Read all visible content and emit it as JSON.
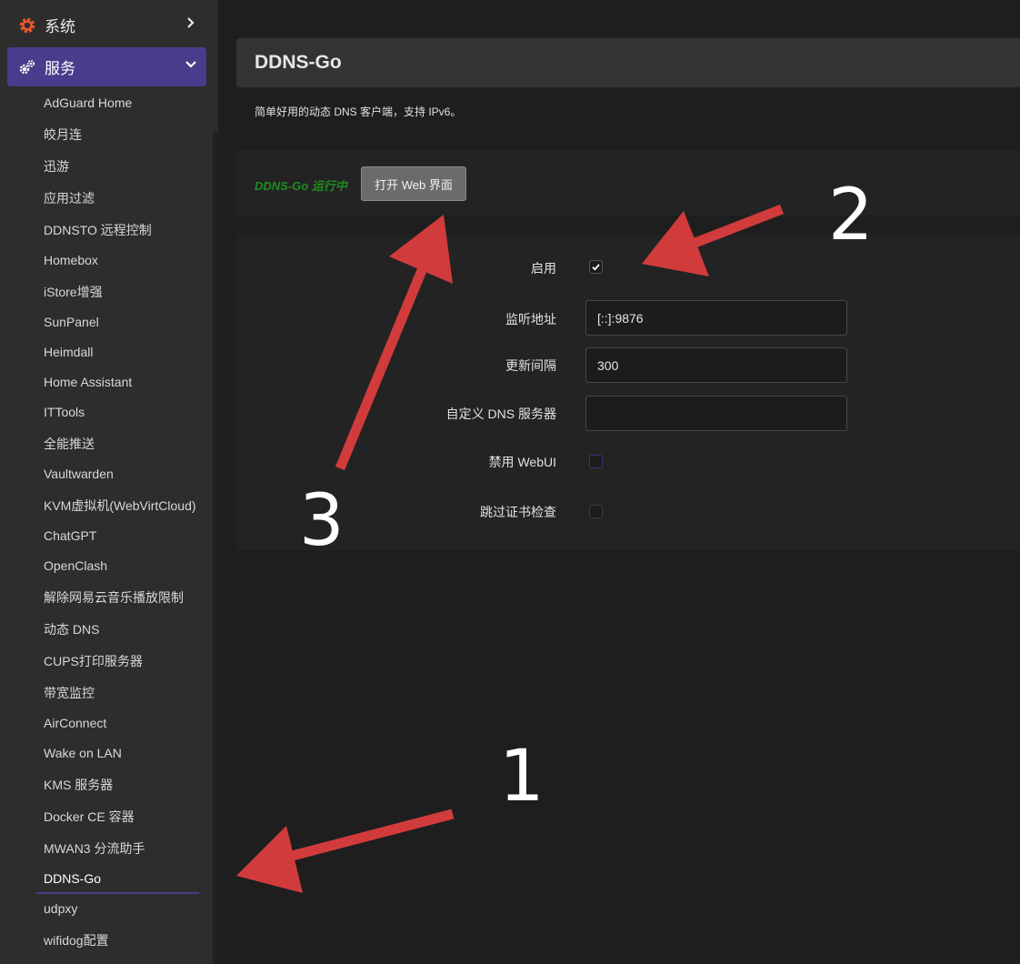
{
  "sidebar": {
    "system_label": "系统",
    "services_label": "服务",
    "items": [
      {
        "label": "AdGuard Home"
      },
      {
        "label": "皎月连"
      },
      {
        "label": "迅游"
      },
      {
        "label": "应用过滤"
      },
      {
        "label": "DDNSTO 远程控制"
      },
      {
        "label": "Homebox"
      },
      {
        "label": "iStore增强"
      },
      {
        "label": "SunPanel"
      },
      {
        "label": "Heimdall"
      },
      {
        "label": "Home Assistant"
      },
      {
        "label": "ITTools"
      },
      {
        "label": "全能推送"
      },
      {
        "label": "Vaultwarden"
      },
      {
        "label": "KVM虚拟机(WebVirtCloud)"
      },
      {
        "label": "ChatGPT"
      },
      {
        "label": "OpenClash"
      },
      {
        "label": "解除网易云音乐播放限制"
      },
      {
        "label": "动态 DNS"
      },
      {
        "label": "CUPS打印服务器"
      },
      {
        "label": "带宽监控"
      },
      {
        "label": "AirConnect"
      },
      {
        "label": "Wake on LAN"
      },
      {
        "label": "KMS 服务器"
      },
      {
        "label": "Docker CE 容器"
      },
      {
        "label": "MWAN3 分流助手"
      },
      {
        "label": "DDNS-Go"
      },
      {
        "label": "udpxy"
      },
      {
        "label": "wifidog配置"
      }
    ],
    "active_item": "DDNS-Go"
  },
  "page": {
    "title": "DDNS-Go",
    "description": "简单好用的动态 DNS 客户端，支持 IPv6。"
  },
  "status": {
    "text": "DDNS-Go 运行中",
    "open_web_button": "打开 Web 界面"
  },
  "form": {
    "enable_label": "启用",
    "enable_checked": true,
    "listen_label": "监听地址",
    "listen_value": "[::]:9876",
    "interval_label": "更新间隔",
    "interval_value": "300",
    "dns_label": "自定义 DNS 服务器",
    "dns_value": "",
    "disable_webui_label": "禁用 WebUI",
    "disable_webui_checked": false,
    "skip_cert_label": "跳过证书检查",
    "skip_cert_checked": false
  },
  "annotations": {
    "n1": "1",
    "n2": "2",
    "n3": "3",
    "arrow_color": "#d23b3b"
  },
  "colors": {
    "accent": "#4a3c8c",
    "status_green": "#1e8c1e",
    "gear_orange": "#e8572a"
  }
}
